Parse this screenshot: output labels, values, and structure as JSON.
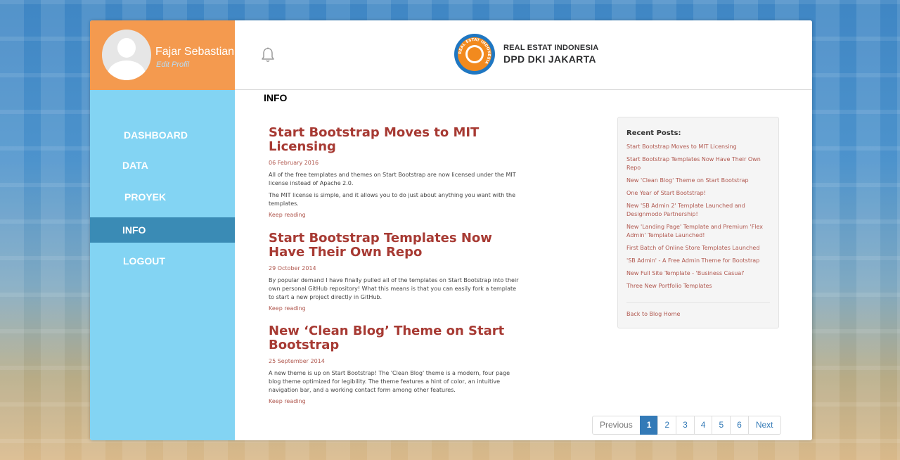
{
  "profile": {
    "name": "Fajar Sebastian",
    "edit_label": "Edit Profil"
  },
  "sidebar": {
    "items": [
      {
        "label": "DASHBOARD"
      },
      {
        "label": "DATA"
      },
      {
        "label": "PROYEK"
      },
      {
        "label": "INFO",
        "active": true
      },
      {
        "label": "LOGOUT"
      }
    ]
  },
  "header": {
    "logo_line1": "REAL ESTAT INDONESIA",
    "logo_line2": "DPD DKI JAKARTA",
    "logo_ring_text": "REAL ESTAT INDONESIA"
  },
  "page_title": "INFO",
  "posts": [
    {
      "title": "Start Bootstrap Moves to MIT Licensing",
      "date": "06 February 2016",
      "paragraphs": [
        "All of the free templates and themes on Start Bootstrap are now licensed under the MIT license instead of Apache 2.0.",
        "The MIT license is simple, and it allows you to do just about anything you want with the templates."
      ],
      "link": "Keep reading"
    },
    {
      "title": "Start Bootstrap Templates Now Have Their Own Repo",
      "date": "29 October 2014",
      "paragraphs": [
        "By popular demand I have finally pulled all of the templates on Start Bootstrap into their own personal GitHub repository! What this means is that you can easily fork a template to start a new project directly in GitHub."
      ],
      "link": "Keep reading"
    },
    {
      "title": "New ‘Clean Blog’ Theme on Start Bootstrap",
      "date": "25 September 2014",
      "paragraphs": [
        "A new theme is up on Start Bootstrap! The 'Clean Blog' theme is a modern, four page blog theme optimized for legibility. The theme features a hint of color, an intuitive navigation bar, and a working contact form among other features."
      ],
      "link": "Keep reading"
    }
  ],
  "recent": {
    "title": "Recent Posts:",
    "links": [
      "Start Bootstrap Moves to MIT Licensing",
      "Start Bootstrap Templates Now Have Their Own Repo",
      "New 'Clean Blog' Theme on Start Bootstrap",
      "One Year of Start Bootstrap!",
      "New 'SB Admin 2' Template Launched and Designmodo Partnership!",
      "New 'Landing Page' Template and Premium 'Flex Admin' Template Launched!",
      "First Batch of Online Store Templates Launched",
      "'SB Admin' - A Free Admin Theme for Bootstrap",
      "New Full Site Template - 'Business Casual'",
      "Three New Portfolio Templates"
    ],
    "back_label": "Back to Blog Home"
  },
  "pagination": {
    "previous": "Previous",
    "pages": [
      "1",
      "2",
      "3",
      "4",
      "5",
      "6"
    ],
    "current": "1",
    "next": "Next"
  },
  "colors": {
    "sidebar": "#83d4f3",
    "profile": "#f49a4f",
    "active_nav": "#3a8bb5",
    "post_title": "#a73a33",
    "page_active": "#337ab7"
  },
  "icons": {
    "bell": "bell-icon",
    "avatar": "user-avatar-icon"
  }
}
